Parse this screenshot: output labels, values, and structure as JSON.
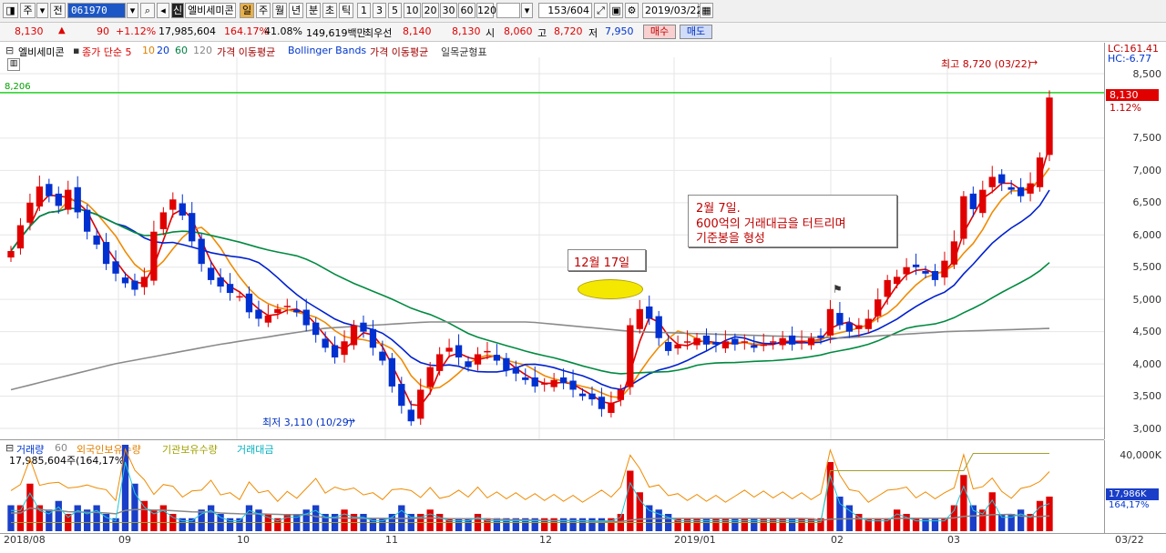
{
  "toolbar": {
    "tab1": "주",
    "tab2": "전",
    "stock_code": "061970",
    "stock_name": "엘비세미콘",
    "badge": "신",
    "period_day": "일",
    "period_week": "주",
    "period_month": "월",
    "period_year": "년",
    "period_min": "분",
    "period_sec": "초",
    "period_tick": "틱",
    "nums": [
      "1",
      "3",
      "5",
      "10",
      "20",
      "30",
      "60",
      "120"
    ],
    "count": "153",
    "total": "/604",
    "date": "2019/03/22"
  },
  "info": {
    "price": "8,130",
    "arrow": "▲",
    "change": "90",
    "change_pct": "+1.12%",
    "volume": "17,985,604",
    "vol_ratio": "164.17%",
    "turnover": "41.08%",
    "amount": "149,619백만",
    "best_ask_label": "최우선",
    "best_ask": "8,140",
    "best_bid": "8,130",
    "open_label": "시",
    "open": "8,060",
    "high_label": "고",
    "high": "8,720",
    "low_label": "저",
    "low": "7,950",
    "buy": "매수",
    "sell": "매도"
  },
  "legend": {
    "name": "엘비세미콘",
    "ma_label": "종가 단순 5",
    "ma10": "10",
    "ma20": "20",
    "ma60": "60",
    "ma120": "120",
    "ind1": "가격 이동평균",
    "ind2": "Bollinger Bands",
    "ind3": "가격 이동평균",
    "ind4": "일목균형표"
  },
  "price_axis": {
    "lc": "LC:161.41",
    "hc": "HC:-6.77",
    "current": "8,130",
    "current_pct": "1.12%",
    "ticks": [
      "8,500",
      "7,500",
      "7,000",
      "6,500",
      "6,000",
      "5,500",
      "5,000",
      "4,500",
      "4,000",
      "3,500",
      "3,000"
    ]
  },
  "hline_label": "8,206",
  "annotations": {
    "high": "최고 8,720 (03/22)",
    "low": "최저 3,110 (10/29)",
    "dec17": "12월 17일",
    "feb7_l1": "2월 7일.",
    "feb7_l2": "600억의 거래대금을 터트리며",
    "feb7_l3": "기준봉을 형성"
  },
  "volume_legend": {
    "vol": "거래량",
    "vol60": "60",
    "foreign": "외국인보유수량",
    "inst": "기관보유수량",
    "amount": "거래대금",
    "value": "17,985,604주(164,17%)"
  },
  "volume_axis": {
    "top": "40,000K",
    "current": "17,986K",
    "pct": "164,17%"
  },
  "date_axis": [
    "2018/08",
    "09",
    "10",
    "11",
    "12",
    "2019/01",
    "02",
    "03",
    "03/22"
  ],
  "chart_data": {
    "type": "candlestick",
    "y_range": [
      2900,
      8800
    ],
    "reference_line": 8206,
    "x_labels": [
      "2018/08",
      "09",
      "10",
      "11",
      "12",
      "2019/01",
      "02",
      "03"
    ],
    "high": {
      "value": 8720,
      "date": "03/22"
    },
    "low": {
      "value": 3110,
      "date": "10/29"
    },
    "closes": [
      5750,
      6150,
      6500,
      6750,
      6600,
      6450,
      6700,
      6350,
      6050,
      5850,
      5550,
      5400,
      5250,
      5150,
      5350,
      6050,
      6350,
      6550,
      6300,
      5900,
      5550,
      5300,
      5200,
      5100,
      5050,
      4800,
      4700,
      4750,
      4850,
      4900,
      4800,
      4600,
      4450,
      4250,
      4100,
      4350,
      4600,
      4500,
      4250,
      4050,
      3650,
      3350,
      3110,
      3600,
      3950,
      4150,
      4250,
      4100,
      3950,
      4150,
      4200,
      4050,
      3900,
      3850,
      3750,
      3650,
      3700,
      3750,
      3700,
      3600,
      3500,
      3450,
      3300,
      3400,
      3600,
      4600,
      4850,
      4700,
      4400,
      4200,
      4300,
      4350,
      4400,
      4300,
      4300,
      4350,
      4300,
      4350,
      4250,
      4300,
      4350,
      4400,
      4300,
      4350,
      4400,
      4400,
      4850,
      4600,
      4500,
      4600,
      4700,
      5000,
      5300,
      5350,
      5500,
      5500,
      5400,
      5300,
      5600,
      5900,
      6600,
      6400,
      6700,
      6900,
      6800,
      6700,
      6600,
      6800,
      7200,
      8130
    ]
  },
  "volume_data": [
    30,
    30,
    55,
    30,
    25,
    35,
    20,
    30,
    25,
    30,
    20,
    15,
    100,
    55,
    35,
    25,
    30,
    20,
    15,
    15,
    25,
    30,
    20,
    15,
    15,
    30,
    25,
    20,
    15,
    20,
    20,
    25,
    30,
    20,
    20,
    25,
    20,
    20,
    15,
    15,
    20,
    30,
    20,
    20,
    25,
    20,
    15,
    15,
    15,
    20,
    15,
    15,
    15,
    15,
    15,
    15,
    15,
    15,
    15,
    15,
    15,
    15,
    15,
    15,
    20,
    70,
    45,
    30,
    25,
    20,
    15,
    15,
    15,
    15,
    15,
    15,
    15,
    15,
    15,
    15,
    15,
    15,
    15,
    15,
    15,
    15,
    80,
    40,
    30,
    20,
    15,
    15,
    15,
    25,
    20,
    15,
    15,
    15,
    15,
    30,
    65,
    30,
    25,
    45,
    20,
    20,
    25,
    20,
    35,
    40
  ]
}
